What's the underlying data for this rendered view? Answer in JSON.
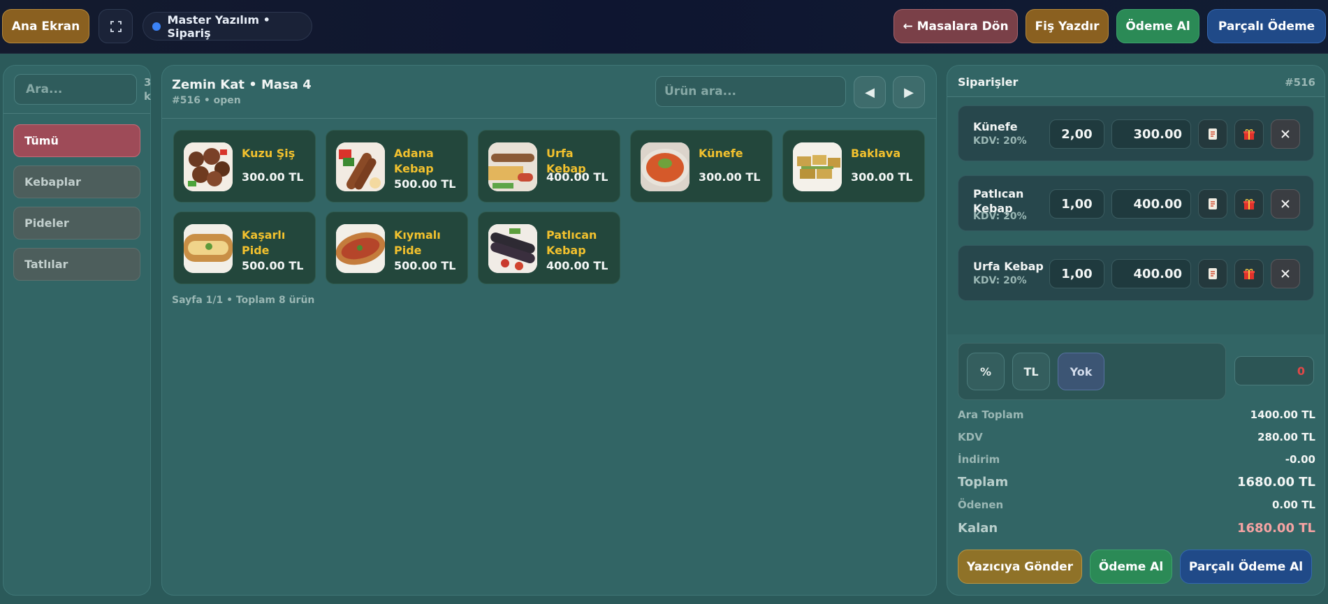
{
  "topbar": {
    "home_label": "Ana Ekran",
    "brand_label": "Master Yazılım • Sipariş",
    "back_label": "← Masalara Dön",
    "print_label": "Fiş Yazdır",
    "pay_label": "Ödeme Al",
    "split_label": "Parçalı Ödeme"
  },
  "categories": {
    "search_placeholder": "Ara...",
    "count_text": "3 k",
    "items": [
      {
        "label": "Tümü",
        "active": true
      },
      {
        "label": "Kebaplar",
        "active": false
      },
      {
        "label": "Pideler",
        "active": false
      },
      {
        "label": "Tatlılar",
        "active": false
      }
    ]
  },
  "table": {
    "title": "Zemin Kat • Masa 4",
    "subtitle": "#516 • open",
    "search_placeholder": "Ürün ara...",
    "prev_icon": "◀",
    "next_icon": "▶"
  },
  "products": [
    {
      "name": "Kuzu Şiş",
      "price": "300.00 TL",
      "icon": "kebab-skewer-icon"
    },
    {
      "name": "Adana Kebap",
      "price": "500.00 TL",
      "icon": "adana-kebab-icon"
    },
    {
      "name": "Urfa Kebap",
      "price": "400.00 TL",
      "icon": "urfa-kebab-icon"
    },
    {
      "name": "Künefe",
      "price": "300.00 TL",
      "icon": "kunefe-icon"
    },
    {
      "name": "Baklava",
      "price": "300.00 TL",
      "icon": "baklava-icon"
    },
    {
      "name": "Kaşarlı Pide",
      "price": "500.00 TL",
      "icon": "pide-icon"
    },
    {
      "name": "Kıymalı Pide",
      "price": "500.00 TL",
      "icon": "pide-icon"
    },
    {
      "name": "Patlıcan Kebap",
      "price": "400.00 TL",
      "icon": "patlican-kebab-icon"
    }
  ],
  "page_info": "Sayfa 1/1 • Toplam 8 ürün",
  "orders": {
    "title": "Siparişler",
    "number": "#516",
    "items": [
      {
        "name": "Künefe",
        "tax": "KDV: 20%",
        "qty": "2,00",
        "price": "300.00"
      },
      {
        "name": "Patlıcan Kebap",
        "tax": "KDV: 20%",
        "qty": "1,00",
        "price": "400.00"
      },
      {
        "name": "Urfa Kebap",
        "tax": "KDV: 20%",
        "qty": "1,00",
        "price": "400.00"
      }
    ]
  },
  "discount": {
    "percent_label": "%",
    "tl_label": "TL",
    "none_label": "Yok",
    "value": "0"
  },
  "summary": {
    "subtotal_label": "Ara Toplam",
    "subtotal": "1400.00 TL",
    "tax_label": "KDV",
    "tax": "280.00 TL",
    "discount_label": "İndirim",
    "discount": "-0.00",
    "total_label": "Toplam",
    "total": "1680.00 TL",
    "paid_label": "Ödenen",
    "paid": "0.00 TL",
    "remaining_label": "Kalan",
    "remaining": "1680.00 TL"
  },
  "actions": {
    "send_printer": "Yazıcıya Gönder",
    "pay": "Ödeme Al",
    "split_pay": "Parçalı Ödeme Al"
  },
  "colors": {
    "accent_gold": "#f2c12e",
    "active_category": "#9e4b58",
    "pay_green": "#2b8a56",
    "split_blue": "#204a88",
    "remaining_red": "#f6a3a3"
  }
}
